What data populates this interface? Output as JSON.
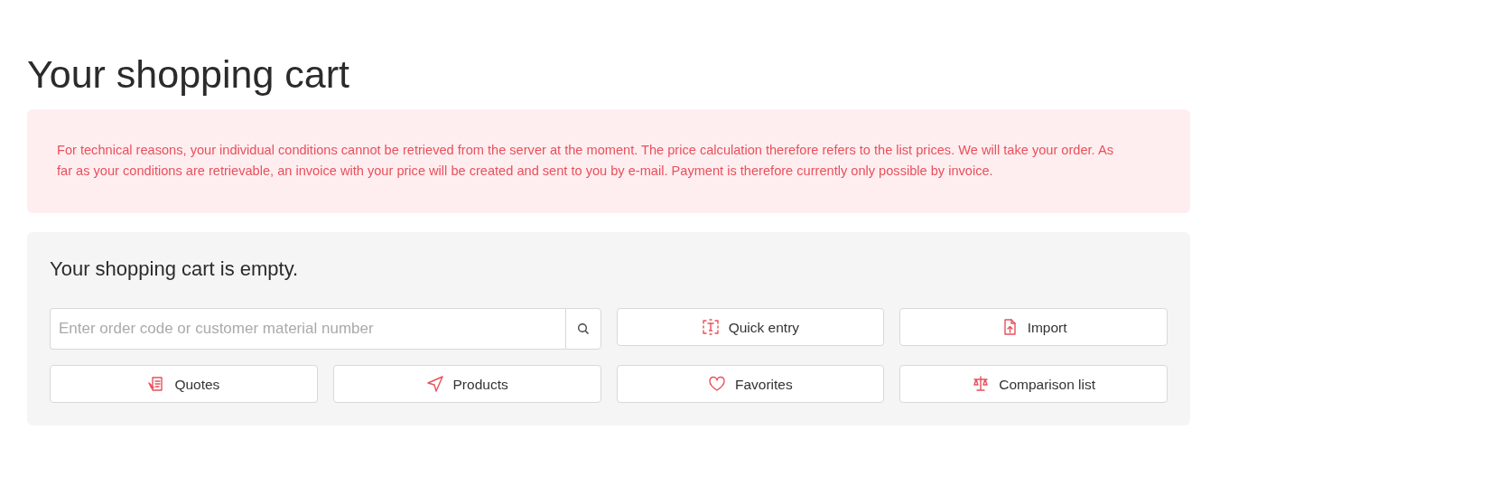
{
  "page_title": "Your shopping cart",
  "alert": {
    "message": "For technical reasons, your individual conditions cannot be retrieved from the server at the moment. The price calculation therefore refers to the list prices. We will take your order. As far as your conditions are retrievable, an invoice with your price will be created and sent to you by e-mail. Payment is therefore currently only possible by invoice."
  },
  "cart": {
    "heading": "Your shopping cart is empty.",
    "search": {
      "placeholder": "Enter order code or customer material number"
    },
    "actions": [
      {
        "label": "Quick entry"
      },
      {
        "label": "Import"
      },
      {
        "label": "Quotes"
      },
      {
        "label": "Products"
      },
      {
        "label": "Favorites"
      },
      {
        "label": "Comparison list"
      }
    ]
  }
}
